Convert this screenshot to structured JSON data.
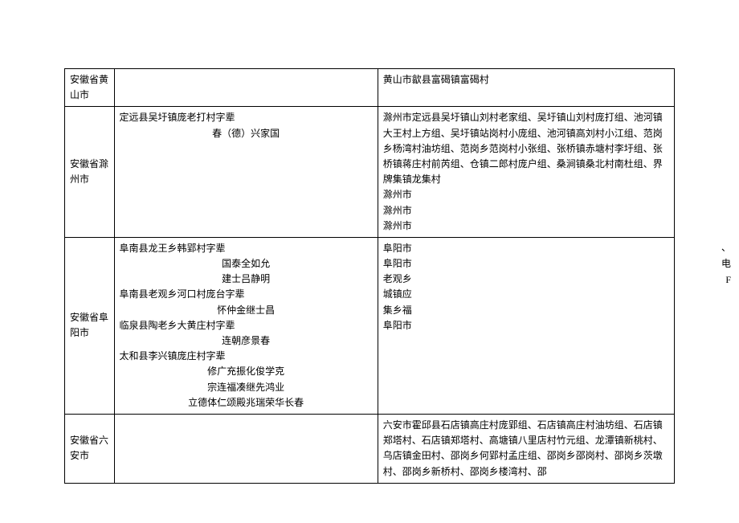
{
  "rows": [
    {
      "city": "安徽省黄山市",
      "col2_lines": [],
      "col3": "黄山市歙县富碣镇富碣村"
    },
    {
      "city": "安徽省滁州市",
      "col2_lines": [
        {
          "text": "定远县吴圩镇庞老打村字辈",
          "align": "left"
        },
        {
          "text": "春（德）兴家国",
          "align": "center"
        }
      ],
      "col3": "滁州市定远县吴圩镇山刘村老家组、吴圩镇山刘村庞打组、池河镇大王村上方组、吴圩镇站岗村小庞组、池河镇高刘村小江组、范岗乡杨湾村油坊组、范岗乡范岗村小张组、张桥镇赤塘村李圩组、张桥镇蒋庄村前芮组、仓镇二郎村庞户组、桑涧镇桑北村南杜组、界牌集镇龙集村\n滁州市\n滁州市\n滁州市"
    },
    {
      "city": "安徽省阜阳市",
      "col2_lines": [
        {
          "text": "阜南县龙王乡韩郢村字辈",
          "align": "left"
        },
        {
          "text": "国泰全如允",
          "align": "center"
        },
        {
          "text": "建士吕静明",
          "align": "center"
        },
        {
          "text": "阜南县老观乡河口村庞台字辈",
          "align": "left"
        },
        {
          "text": "怀仲金继士昌",
          "align": "center"
        },
        {
          "text": "临泉县陶老乡大黄庄村字辈",
          "align": "left"
        },
        {
          "text": "连朝彦景春",
          "align": "center"
        },
        {
          "text": "太和县李兴镇庞庄村字辈",
          "align": "left"
        },
        {
          "text": "修广充振化俊学克",
          "align": "center"
        },
        {
          "text": "宗连福凑继先鸿业",
          "align": "center"
        },
        {
          "text": "立德体仁颂殿兆瑞荣华长春",
          "align": "center"
        }
      ],
      "col3": "阜阳市\n阜阳市\n老观乡\n城镇应\n集乡福\n阜阳市"
    },
    {
      "city": "安徽省六安市",
      "col2_lines": [],
      "col3": "六安市霍邱县石店镇高庄村庞郢组、石店镇高庄村油坊组、石店镇郑塔村、石店镇郑塔村、高塘镇八里店村竹元组、龙潭镇新桃村、乌店镇金田村、邵岗乡何郢村孟庄组、邵岗乡邵岗村、邵岗乡茨墩村、邵岗乡新桥村、邵岗乡楼湾村、邵"
    }
  ],
  "floaters": [
    "、",
    "电",
    "F"
  ]
}
